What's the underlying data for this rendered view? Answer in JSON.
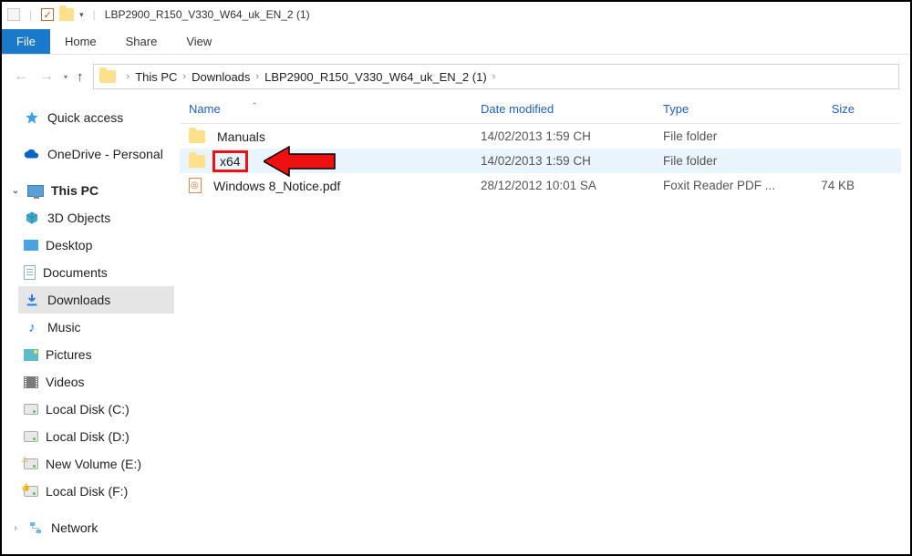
{
  "window": {
    "title": "LBP2900_R150_V330_W64_uk_EN_2 (1)"
  },
  "ribbon": {
    "file": "File",
    "home": "Home",
    "share": "Share",
    "view": "View"
  },
  "breadcrumbs": [
    "This PC",
    "Downloads",
    "LBP2900_R150_V330_W64_uk_EN_2 (1)"
  ],
  "sidebar": {
    "quick_access": "Quick access",
    "onedrive": "OneDrive - Personal",
    "this_pc": "This PC",
    "items": [
      "3D Objects",
      "Desktop",
      "Documents",
      "Downloads",
      "Music",
      "Pictures",
      "Videos",
      "Local Disk (C:)",
      "Local Disk (D:)",
      "New Volume (E:)",
      "Local Disk (F:)"
    ],
    "network": "Network"
  },
  "columns": {
    "name": "Name",
    "date": "Date modified",
    "type": "Type",
    "size": "Size"
  },
  "files": [
    {
      "name": "Manuals",
      "date": "14/02/2013 1:59 CH",
      "type": "File folder",
      "size": "",
      "icon": "folder"
    },
    {
      "name": "x64",
      "date": "14/02/2013 1:59 CH",
      "type": "File folder",
      "size": "",
      "icon": "folder",
      "highlighted": true
    },
    {
      "name": "Windows 8_Notice.pdf",
      "date": "28/12/2012 10:01 SA",
      "type": "Foxit Reader PDF ...",
      "size": "74 KB",
      "icon": "pdf"
    }
  ]
}
